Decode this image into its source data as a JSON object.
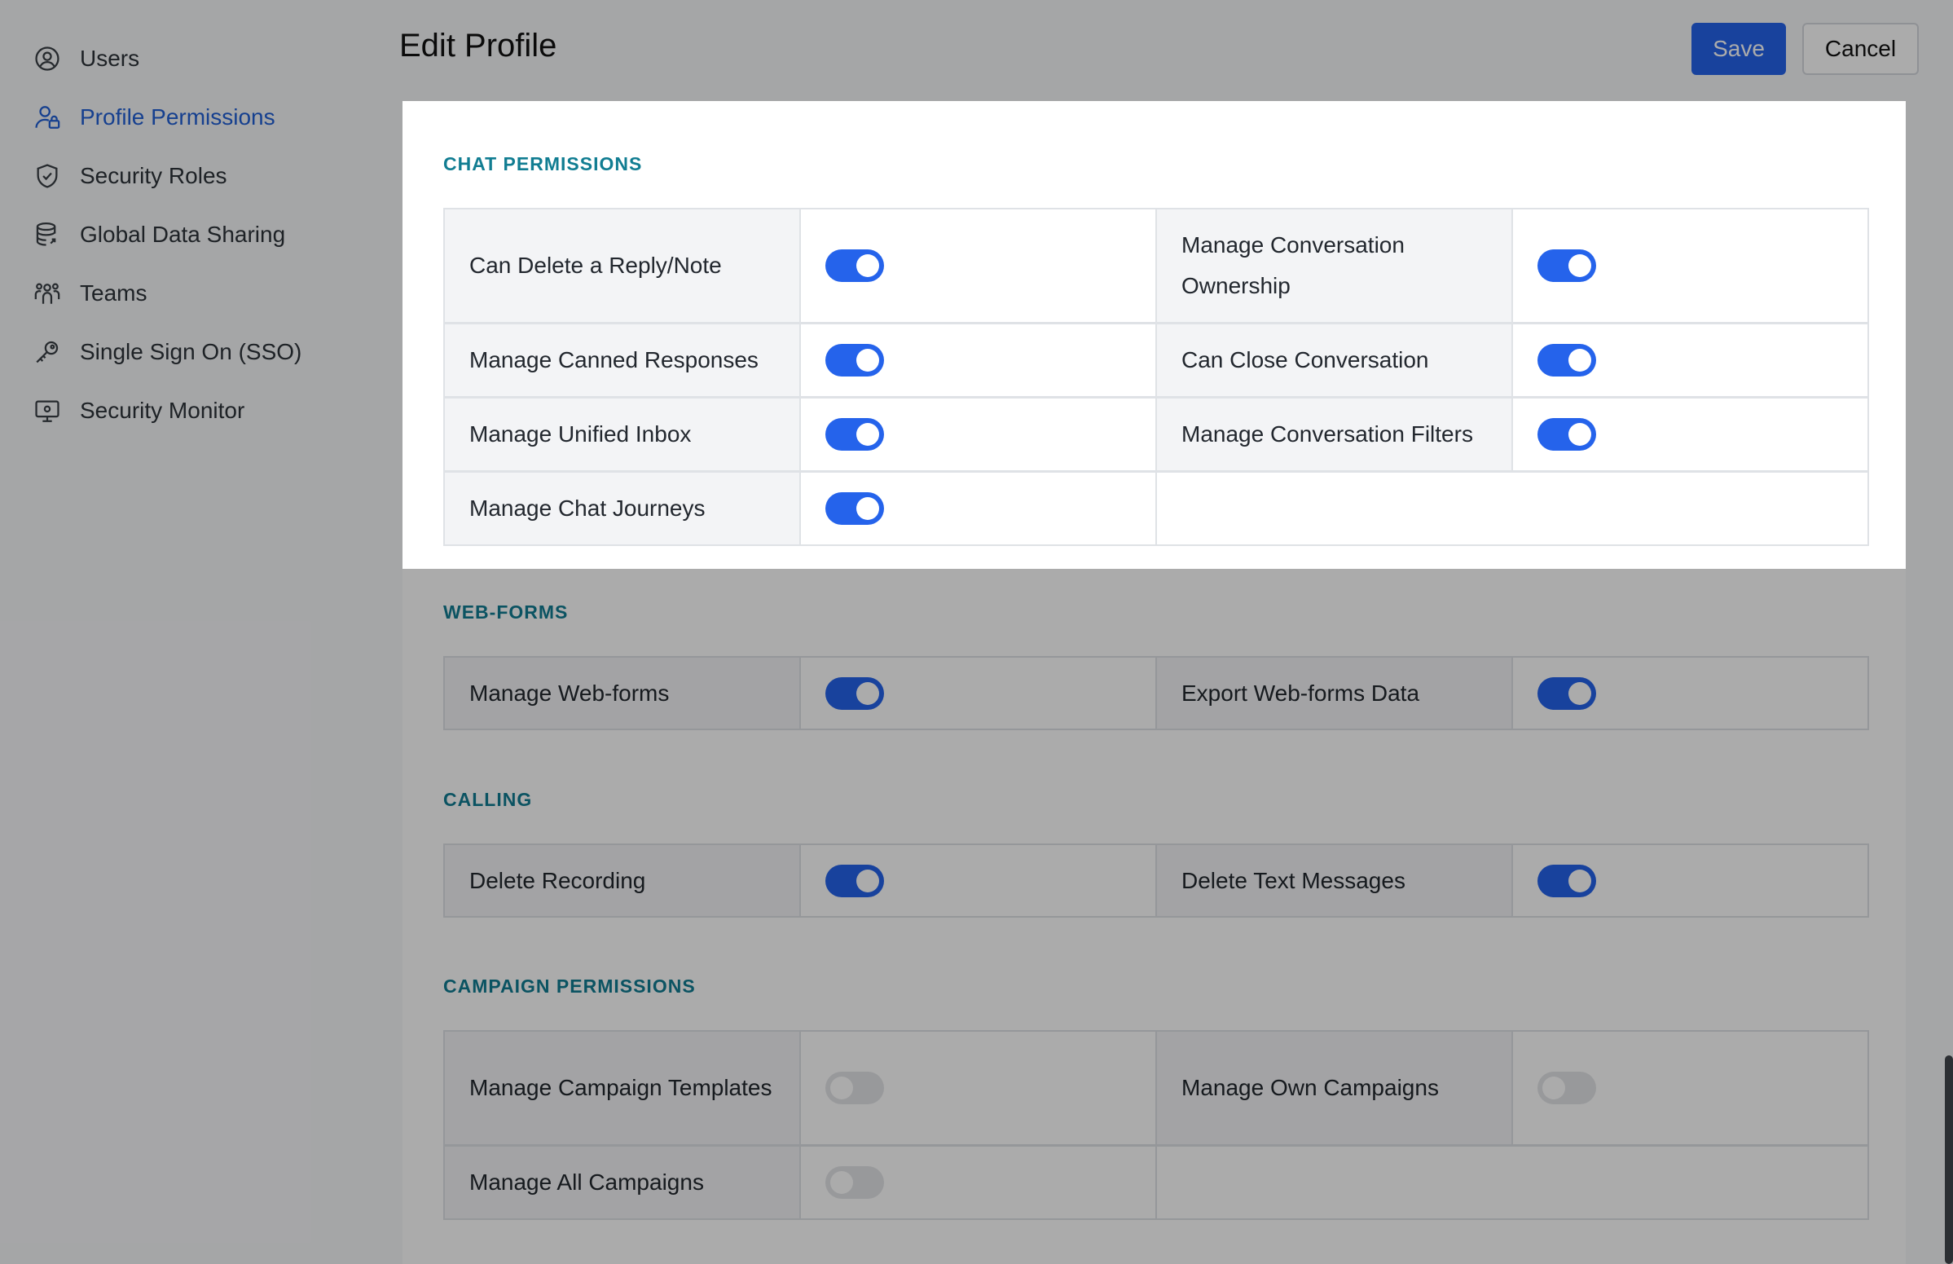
{
  "sidebar": {
    "items": [
      {
        "label": "Users",
        "icon": "user-circle-icon",
        "active": false
      },
      {
        "label": "Profile Permissions",
        "icon": "user-lock-icon",
        "active": true
      },
      {
        "label": "Security Roles",
        "icon": "shield-check-icon",
        "active": false
      },
      {
        "label": "Global Data Sharing",
        "icon": "database-share-icon",
        "active": false
      },
      {
        "label": "Teams",
        "icon": "team-icon",
        "active": false
      },
      {
        "label": "Single Sign On (SSO)",
        "icon": "key-icon",
        "active": false
      },
      {
        "label": "Security Monitor",
        "icon": "monitor-icon",
        "active": false
      }
    ]
  },
  "header": {
    "title": "Edit Profile",
    "save_label": "Save",
    "cancel_label": "Cancel"
  },
  "sections": {
    "chat": {
      "title": "CHAT PERMISSIONS",
      "perms": [
        {
          "label": "Can Delete a Reply/Note",
          "enabled": true
        },
        {
          "label": "Manage Conversation Ownership",
          "enabled": true
        },
        {
          "label": "Manage Canned Responses",
          "enabled": true
        },
        {
          "label": "Can Close Conversation",
          "enabled": true
        },
        {
          "label": "Manage Unified Inbox",
          "enabled": true
        },
        {
          "label": "Manage Conversation Filters",
          "enabled": true
        },
        {
          "label": "Manage Chat Journeys",
          "enabled": true
        }
      ]
    },
    "webforms": {
      "title": "WEB-FORMS",
      "perms": [
        {
          "label": "Manage Web-forms",
          "enabled": true
        },
        {
          "label": "Export Web-forms Data",
          "enabled": true
        }
      ]
    },
    "calling": {
      "title": "CALLING",
      "perms": [
        {
          "label": "Delete Recording",
          "enabled": true
        },
        {
          "label": "Delete Text Messages",
          "enabled": true
        }
      ]
    },
    "campaign": {
      "title": "CAMPAIGN PERMISSIONS",
      "perms": [
        {
          "label": "Manage Campaign Templates",
          "enabled": false
        },
        {
          "label": "Manage Own Campaigns",
          "enabled": false
        },
        {
          "label": "Manage All Campaigns",
          "enabled": false
        }
      ]
    }
  },
  "colors": {
    "accent": "#2563eb",
    "active_nav": "#2160d6",
    "section_title": "#117d92"
  }
}
